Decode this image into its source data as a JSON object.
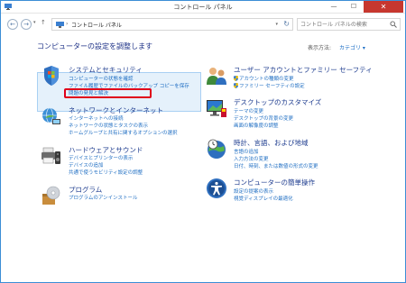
{
  "window": {
    "title": "コントロール パネル",
    "min_glyph": "—",
    "max_glyph": "☐",
    "close_glyph": "✕"
  },
  "address": {
    "nav_back": "←",
    "nav_fwd": "→",
    "nav_dropdown": "▾",
    "nav_up": "↑",
    "sep": "›",
    "path": "コントロール パネル",
    "dropdown": "▾",
    "refresh": "↻",
    "search_placeholder": "コントロール パネルの検索"
  },
  "main": {
    "heading": "コンピューターの設定を調整します",
    "view_label": "表示方法:",
    "view_value": "カテゴリ ▾"
  },
  "categories_left": [
    {
      "title": "システムとセキュリティ",
      "icon": "shield-flag-icon",
      "links": [
        "コンピューターの状態を確認",
        "ファイル履歴でファイルのバックアップ コピーを保存",
        "問題の発見と解決"
      ]
    },
    {
      "title": "ネットワークとインターネット",
      "icon": "network-globe-icon",
      "links": [
        "インターネットへの接続",
        "ネットワークの状態とタスクの表示",
        "ホームグループと共有に関するオプションの選択"
      ]
    },
    {
      "title": "ハードウェアとサウンド",
      "icon": "printer-speaker-icon",
      "links": [
        "デバイスとプリンターの表示",
        "デバイスの追加",
        "共通で使うモビリティ設定の調整"
      ]
    },
    {
      "title": "プログラム",
      "icon": "programs-disc-icon",
      "links": [
        "プログラムのアンインストール"
      ]
    }
  ],
  "categories_right": [
    {
      "title": "ユーザー アカウントとファミリー セーフティ",
      "icon": "users-icon",
      "links": [
        "アカウントの種類の変更",
        "ファミリー セーフティの設定"
      ]
    },
    {
      "title": "デスクトップのカスタマイズ",
      "icon": "desktop-monitor-icon",
      "links": [
        "テーマの変更",
        "デスクトップの背景の変更",
        "画面の解像度の調整"
      ]
    },
    {
      "title": "時計、言語、および地域",
      "icon": "clock-globe-icon",
      "links": [
        "言語の追加",
        "入力方法の変更",
        "日付、時刻、または数値の形式の変更"
      ]
    },
    {
      "title": "コンピューターの簡単操作",
      "icon": "ease-of-access-icon",
      "links": [
        "設定の提案の表示",
        "視覚ディスプレイの最適化"
      ]
    }
  ],
  "colors": {
    "heading": "#1e3287",
    "link": "#1f6ec3",
    "highlight_bg": "#e5f1fb",
    "highlight_annotation": "#e0001a"
  }
}
